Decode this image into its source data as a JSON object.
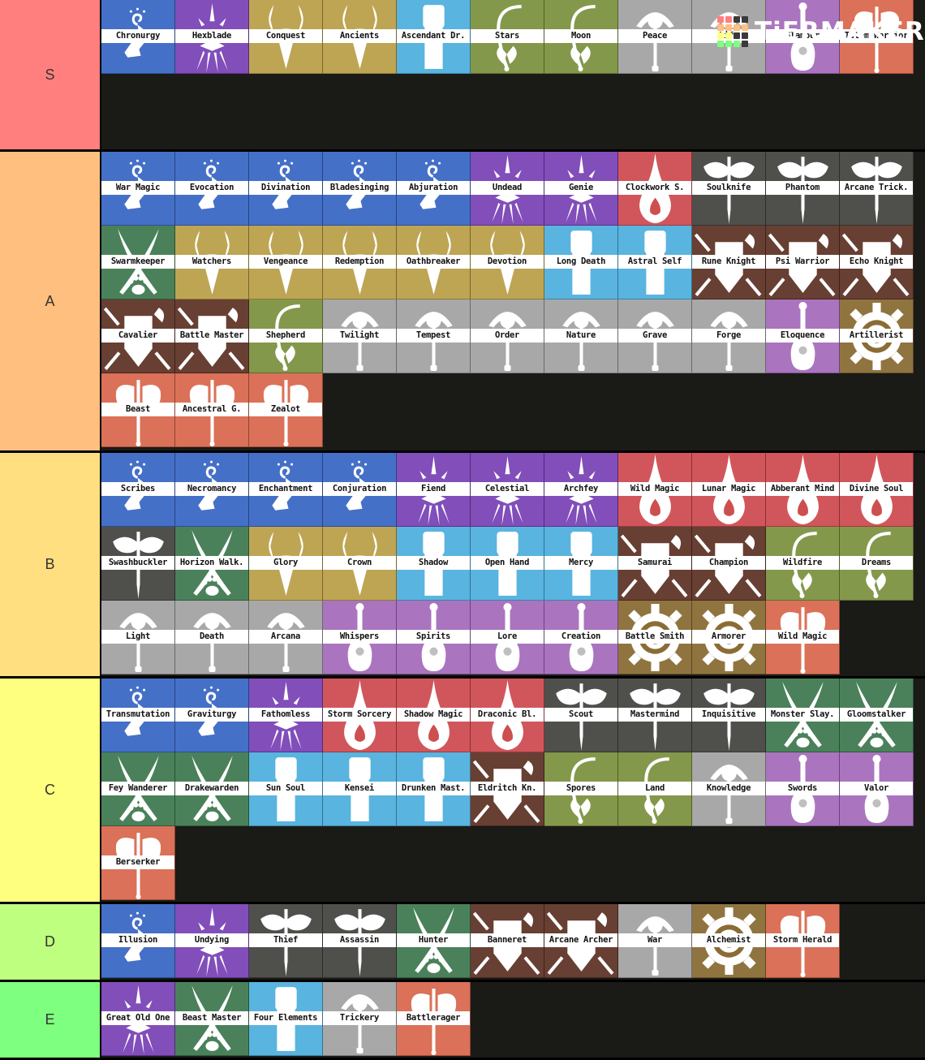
{
  "brand": {
    "name": "TiERMAKER",
    "logo_grid_colors": [
      "#ff7f7f",
      "#ff7f7f",
      "#3a3a3a",
      "#3a3a3a",
      "#ffbf7f",
      "#ffbf7f",
      "#ffbf7f",
      "#ffbf7f",
      "#ffff7f",
      "#ffff7f",
      "#3a3a3a",
      "#3a3a3a",
      "#7fff7f",
      "#7fff7f",
      "#7fff7f",
      "#3a3a3a"
    ]
  },
  "categories": {
    "wizard": {
      "icon": "hand-spiral-icon",
      "color": "#3a68c4"
    },
    "warlock": {
      "icon": "spiked-star-icon",
      "color": "#7a43b6"
    },
    "paladin": {
      "icon": "horned-helm-icon",
      "color": "#b9a04a"
    },
    "monk": {
      "icon": "fist-icon",
      "color": "#4fb0dd"
    },
    "druid": {
      "icon": "sickle-icon",
      "color": "#7d9240"
    },
    "cleric": {
      "icon": "sun-mace-icon",
      "color": "#a3a3a3"
    },
    "bard": {
      "icon": "lute-icon",
      "color": "#a56cbc"
    },
    "barbarian": {
      "icon": "double-axe-icon",
      "color": "#d9694e"
    },
    "sorcerer": {
      "icon": "flame-drop-icon",
      "color": "#cf4c52"
    },
    "rogue": {
      "icon": "mask-dagger-icon",
      "color": "#444441"
    },
    "ranger": {
      "icon": "crossed-blades-paw-icon",
      "color": "#3f7a50"
    },
    "fighter": {
      "icon": "shield-weapons-icon",
      "color": "#5f3327"
    },
    "artificer": {
      "icon": "gear-icon",
      "color": "#8a6c35"
    }
  },
  "tiers": [
    {
      "label": "S",
      "color": "#ff7f7f",
      "items": [
        {
          "name": "Chronurgy",
          "cls": "wizard"
        },
        {
          "name": "Hexblade",
          "cls": "warlock"
        },
        {
          "name": "Conquest",
          "cls": "paladin"
        },
        {
          "name": "Ancients",
          "cls": "paladin"
        },
        {
          "name": "Ascendant Dr.",
          "cls": "monk"
        },
        {
          "name": "Stars",
          "cls": "druid"
        },
        {
          "name": "Moon",
          "cls": "druid"
        },
        {
          "name": "Peace",
          "cls": "cleric"
        },
        {
          "name": "Life",
          "cls": "cleric"
        },
        {
          "name": "Glamour",
          "cls": "bard"
        },
        {
          "name": "Totem Warrior",
          "cls": "barbarian"
        }
      ]
    },
    {
      "label": "A",
      "color": "#ffbf7f",
      "items": [
        {
          "name": "War Magic",
          "cls": "wizard"
        },
        {
          "name": "Evocation",
          "cls": "wizard"
        },
        {
          "name": "Divination",
          "cls": "wizard"
        },
        {
          "name": "Bladesinging",
          "cls": "wizard"
        },
        {
          "name": "Abjuration",
          "cls": "wizard"
        },
        {
          "name": "Undead",
          "cls": "warlock"
        },
        {
          "name": "Genie",
          "cls": "warlock"
        },
        {
          "name": "Clockwork S.",
          "cls": "sorcerer"
        },
        {
          "name": "Soulknife",
          "cls": "rogue"
        },
        {
          "name": "Phantom",
          "cls": "rogue"
        },
        {
          "name": "Arcane Trick.",
          "cls": "rogue"
        },
        {
          "name": "Swarmkeeper",
          "cls": "ranger"
        },
        {
          "name": "Watchers",
          "cls": "paladin"
        },
        {
          "name": "Vengeance",
          "cls": "paladin"
        },
        {
          "name": "Redemption",
          "cls": "paladin"
        },
        {
          "name": "Oathbreaker",
          "cls": "paladin"
        },
        {
          "name": "Devotion",
          "cls": "paladin"
        },
        {
          "name": "Long Death",
          "cls": "monk"
        },
        {
          "name": "Astral Self",
          "cls": "monk"
        },
        {
          "name": "Rune Knight",
          "cls": "fighter"
        },
        {
          "name": "Psi Warrior",
          "cls": "fighter"
        },
        {
          "name": "Echo Knight",
          "cls": "fighter"
        },
        {
          "name": "Cavalier",
          "cls": "fighter"
        },
        {
          "name": "Battle Master",
          "cls": "fighter"
        },
        {
          "name": "Shepherd",
          "cls": "druid"
        },
        {
          "name": "Twilight",
          "cls": "cleric"
        },
        {
          "name": "Tempest",
          "cls": "cleric"
        },
        {
          "name": "Order",
          "cls": "cleric"
        },
        {
          "name": "Nature",
          "cls": "cleric"
        },
        {
          "name": "Grave",
          "cls": "cleric"
        },
        {
          "name": "Forge",
          "cls": "cleric"
        },
        {
          "name": "Eloquence",
          "cls": "bard"
        },
        {
          "name": "Artillerist",
          "cls": "artificer"
        },
        {
          "name": "Beast",
          "cls": "barbarian"
        },
        {
          "name": "Ancestral G.",
          "cls": "barbarian"
        },
        {
          "name": "Zealot",
          "cls": "barbarian"
        }
      ]
    },
    {
      "label": "B",
      "color": "#ffdf7f",
      "items": [
        {
          "name": "Scribes",
          "cls": "wizard"
        },
        {
          "name": "Necromancy",
          "cls": "wizard"
        },
        {
          "name": "Enchantment",
          "cls": "wizard"
        },
        {
          "name": "Conjuration",
          "cls": "wizard"
        },
        {
          "name": "Fiend",
          "cls": "warlock"
        },
        {
          "name": "Celestial",
          "cls": "warlock"
        },
        {
          "name": "Archfey",
          "cls": "warlock"
        },
        {
          "name": "Wild Magic",
          "cls": "sorcerer"
        },
        {
          "name": "Lunar Magic",
          "cls": "sorcerer"
        },
        {
          "name": "Abberant Mind",
          "cls": "sorcerer"
        },
        {
          "name": "Divine Soul",
          "cls": "sorcerer"
        },
        {
          "name": "Swashbuckler",
          "cls": "rogue"
        },
        {
          "name": "Horizon Walk.",
          "cls": "ranger"
        },
        {
          "name": "Glory",
          "cls": "paladin"
        },
        {
          "name": "Crown",
          "cls": "paladin"
        },
        {
          "name": "Shadow",
          "cls": "monk"
        },
        {
          "name": "Open Hand",
          "cls": "monk"
        },
        {
          "name": "Mercy",
          "cls": "monk"
        },
        {
          "name": "Samurai",
          "cls": "fighter"
        },
        {
          "name": "Champion",
          "cls": "fighter"
        },
        {
          "name": "Wildfire",
          "cls": "druid"
        },
        {
          "name": "Dreams",
          "cls": "druid"
        },
        {
          "name": "Light",
          "cls": "cleric"
        },
        {
          "name": "Death",
          "cls": "cleric"
        },
        {
          "name": "Arcana",
          "cls": "cleric"
        },
        {
          "name": "Whispers",
          "cls": "bard"
        },
        {
          "name": "Spirits",
          "cls": "bard"
        },
        {
          "name": "Lore",
          "cls": "bard"
        },
        {
          "name": "Creation",
          "cls": "bard"
        },
        {
          "name": "Battle Smith",
          "cls": "artificer"
        },
        {
          "name": "Armorer",
          "cls": "artificer"
        },
        {
          "name": "Wild Magic",
          "cls": "barbarian"
        }
      ]
    },
    {
      "label": "C",
      "color": "#ffff7f",
      "items": [
        {
          "name": "Transmutation",
          "cls": "wizard"
        },
        {
          "name": "Graviturgy",
          "cls": "wizard"
        },
        {
          "name": "Fathomless",
          "cls": "warlock"
        },
        {
          "name": "Storm Sorcery",
          "cls": "sorcerer"
        },
        {
          "name": "Shadow Magic",
          "cls": "sorcerer"
        },
        {
          "name": "Draconic Bl.",
          "cls": "sorcerer"
        },
        {
          "name": "Scout",
          "cls": "rogue"
        },
        {
          "name": "Mastermind",
          "cls": "rogue"
        },
        {
          "name": "Inquisitive",
          "cls": "rogue"
        },
        {
          "name": "Monster Slay.",
          "cls": "ranger"
        },
        {
          "name": "Gloomstalker",
          "cls": "ranger"
        },
        {
          "name": "Fey Wanderer",
          "cls": "ranger"
        },
        {
          "name": "Drakewarden",
          "cls": "ranger"
        },
        {
          "name": "Sun Soul",
          "cls": "monk"
        },
        {
          "name": "Kensei",
          "cls": "monk"
        },
        {
          "name": "Drunken Mast.",
          "cls": "monk"
        },
        {
          "name": "Eldritch Kn.",
          "cls": "fighter"
        },
        {
          "name": "Spores",
          "cls": "druid"
        },
        {
          "name": "Land",
          "cls": "druid"
        },
        {
          "name": "Knowledge",
          "cls": "cleric"
        },
        {
          "name": "Swords",
          "cls": "bard"
        },
        {
          "name": "Valor",
          "cls": "bard"
        },
        {
          "name": "Berserker",
          "cls": "barbarian"
        }
      ]
    },
    {
      "label": "D",
      "color": "#bfff7f",
      "items": [
        {
          "name": "Illusion",
          "cls": "wizard"
        },
        {
          "name": "Undying",
          "cls": "warlock"
        },
        {
          "name": "Thief",
          "cls": "rogue"
        },
        {
          "name": "Assassin",
          "cls": "rogue"
        },
        {
          "name": "Hunter",
          "cls": "ranger"
        },
        {
          "name": "Banneret",
          "cls": "fighter"
        },
        {
          "name": "Arcane Archer",
          "cls": "fighter"
        },
        {
          "name": "War",
          "cls": "cleric"
        },
        {
          "name": "Alchemist",
          "cls": "artificer"
        },
        {
          "name": "Storm Herald",
          "cls": "barbarian"
        }
      ]
    },
    {
      "label": "E",
      "color": "#7fff7f",
      "items": [
        {
          "name": "Great Old One",
          "cls": "warlock"
        },
        {
          "name": "Beast Master",
          "cls": "ranger"
        },
        {
          "name": "Four Elements",
          "cls": "monk"
        },
        {
          "name": "Trickery",
          "cls": "cleric"
        },
        {
          "name": "Battlerager",
          "cls": "barbarian"
        }
      ]
    }
  ]
}
